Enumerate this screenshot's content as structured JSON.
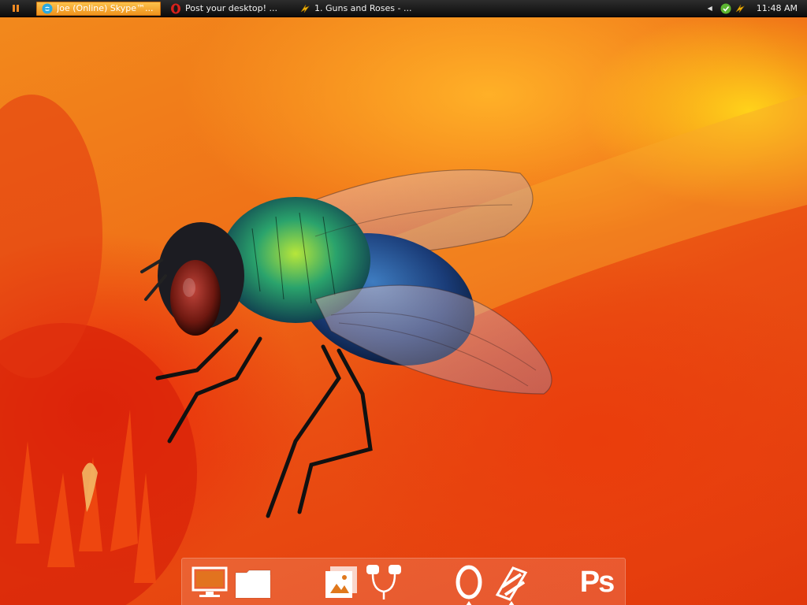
{
  "taskbar": {
    "tasks": [
      {
        "label": "Joe (Online) Skype™...",
        "icon": "skype-icon",
        "active": true
      },
      {
        "label": "Post your desktop! ...",
        "icon": "opera-icon",
        "active": false
      },
      {
        "label": "1. Guns and Roses - ...",
        "icon": "winamp-icon",
        "active": false
      }
    ],
    "clock": "11:48 AM"
  },
  "dock": {
    "items": [
      {
        "icon": "monitor-icon",
        "running": false
      },
      {
        "icon": "folder-icon",
        "running": false
      },
      {
        "icon": "photos-icon",
        "running": false
      },
      {
        "icon": "headphones-icon",
        "running": false
      },
      {
        "icon": "opera-icon",
        "running": true
      },
      {
        "icon": "winamp-icon",
        "running": true
      },
      {
        "icon": "photoshop-icon",
        "label": "Ps",
        "running": false
      }
    ]
  },
  "colors": {
    "taskbar_bg": "#111111",
    "active_task": "#f5a623",
    "wallpaper_primary": "#f07218",
    "wallpaper_accent": "#ffd21a"
  }
}
